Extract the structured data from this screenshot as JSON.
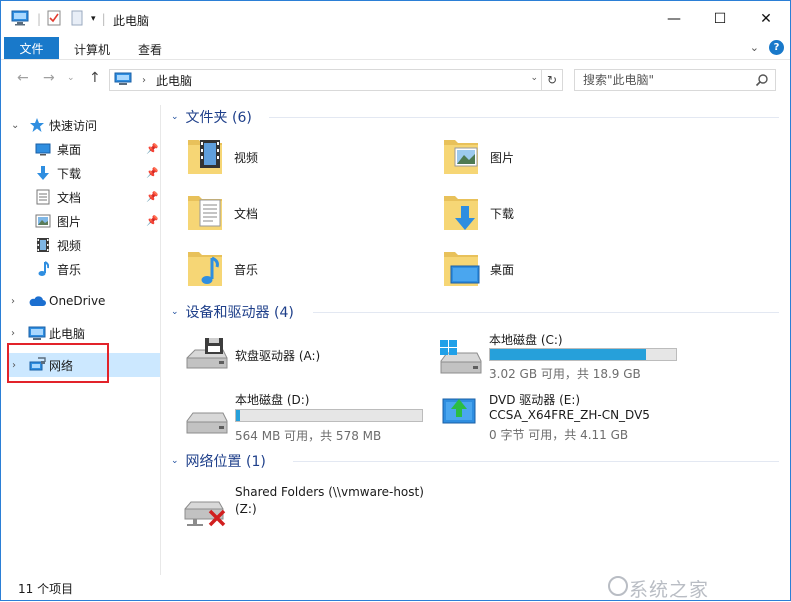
{
  "window": {
    "title": "此电脑",
    "minimize": "—",
    "maximize": "☐",
    "close": "✕"
  },
  "ribbon": {
    "file_tab": "文件",
    "tabs": [
      "计算机",
      "查看"
    ]
  },
  "address": {
    "path": "此电脑",
    "chevron": "›",
    "dropdown": "⌄",
    "refresh": "↻"
  },
  "search": {
    "placeholder": "搜索\"此电脑\""
  },
  "sidebar": {
    "quick_access": "快速访问",
    "pinned": [
      "桌面",
      "下载",
      "文档",
      "图片"
    ],
    "items": [
      "视频",
      "音乐"
    ],
    "onedrive": "OneDrive",
    "this_pc": "此电脑",
    "network": "网络"
  },
  "folders": {
    "header": "文件夹 (6)",
    "items": [
      "视频",
      "图片",
      "文档",
      "下载",
      "音乐",
      "桌面"
    ]
  },
  "devices": {
    "header": "设备和驱动器 (4)",
    "floppy": {
      "name": "软盘驱动器 (A:)"
    },
    "c": {
      "name": "本地磁盘 (C:)",
      "free": "3.02 GB 可用，共 18.9 GB",
      "used_fraction": 0.84
    },
    "d": {
      "name": "本地磁盘 (D:)",
      "free": "564 MB 可用，共 578 MB",
      "used_fraction": 0.02
    },
    "e": {
      "name": "DVD 驱动器 (E:)",
      "label": "CCSA_X64FRE_ZH-CN_DV5",
      "free": "0 字节 可用，共 4.11 GB"
    }
  },
  "network_locations": {
    "header": "网络位置 (1)",
    "share": {
      "name": "Shared Folders (\\\\vmware-host)",
      "drive": "(Z:)"
    }
  },
  "status": {
    "count": "11 个项目"
  },
  "watermark": "系统之家",
  "colors": {
    "accent": "#1979ca",
    "bar_fill": "#26a0da",
    "header_text": "#1e3f8a",
    "selection": "#cce8ff",
    "highlight_box": "#e2232a"
  }
}
